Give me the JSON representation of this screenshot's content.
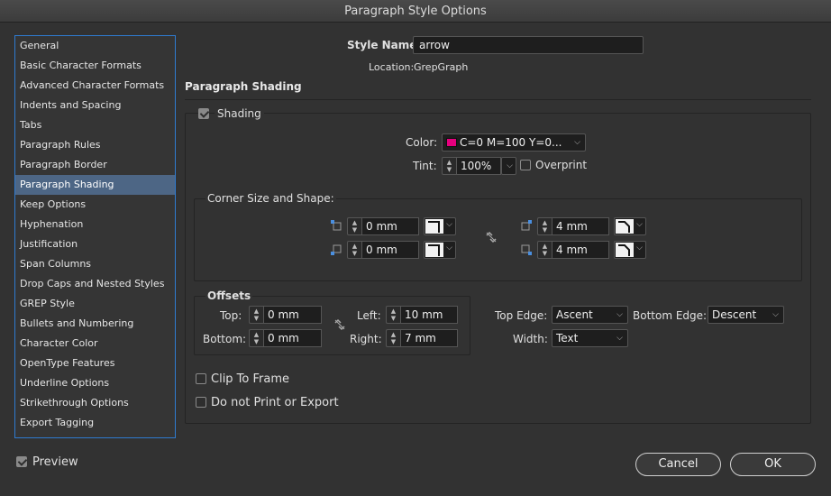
{
  "window": {
    "title": "Paragraph Style Options"
  },
  "sidebar": {
    "items": [
      {
        "label": "General"
      },
      {
        "label": "Basic Character Formats"
      },
      {
        "label": "Advanced Character Formats"
      },
      {
        "label": "Indents and Spacing"
      },
      {
        "label": "Tabs"
      },
      {
        "label": "Paragraph Rules"
      },
      {
        "label": "Paragraph Border"
      },
      {
        "label": "Paragraph Shading",
        "selected": true
      },
      {
        "label": "Keep Options"
      },
      {
        "label": "Hyphenation"
      },
      {
        "label": "Justification"
      },
      {
        "label": "Span Columns"
      },
      {
        "label": "Drop Caps and Nested Styles"
      },
      {
        "label": "GREP Style"
      },
      {
        "label": "Bullets and Numbering"
      },
      {
        "label": "Character Color"
      },
      {
        "label": "OpenType Features"
      },
      {
        "label": "Underline Options"
      },
      {
        "label": "Strikethrough Options"
      },
      {
        "label": "Export Tagging"
      }
    ]
  },
  "header": {
    "style_name_label": "Style Name:",
    "style_name_value": "arrow",
    "location_label": "Location:",
    "location_value": "GrepGraph"
  },
  "section": {
    "title": "Paragraph Shading"
  },
  "shading": {
    "label": "Shading",
    "checked": true,
    "color_label": "Color:",
    "color_value": "C=0 M=100 Y=0...",
    "color_swatch": "#e5007e",
    "tint_label": "Tint:",
    "tint_value": "100%",
    "overprint_label": "Overprint"
  },
  "corners": {
    "title": "Corner Size and Shape:",
    "top_left": "0 mm",
    "bottom_left": "0 mm",
    "top_right": "4 mm",
    "bottom_right": "4 mm"
  },
  "offsets": {
    "title": "Offsets",
    "top_label": "Top:",
    "top_value": "0 mm",
    "bottom_label": "Bottom:",
    "bottom_value": "0 mm",
    "left_label": "Left:",
    "left_value": "10 mm",
    "right_label": "Right:",
    "right_value": "7 mm"
  },
  "edges": {
    "top_edge_label": "Top Edge:",
    "top_edge_value": "Ascent",
    "bottom_edge_label": "Bottom Edge:",
    "bottom_edge_value": "Descent",
    "width_label": "Width:",
    "width_value": "Text"
  },
  "options": {
    "clip_label": "Clip To Frame",
    "noprint_label": "Do not Print or Export"
  },
  "footer": {
    "preview_label": "Preview",
    "cancel_label": "Cancel",
    "ok_label": "OK"
  }
}
